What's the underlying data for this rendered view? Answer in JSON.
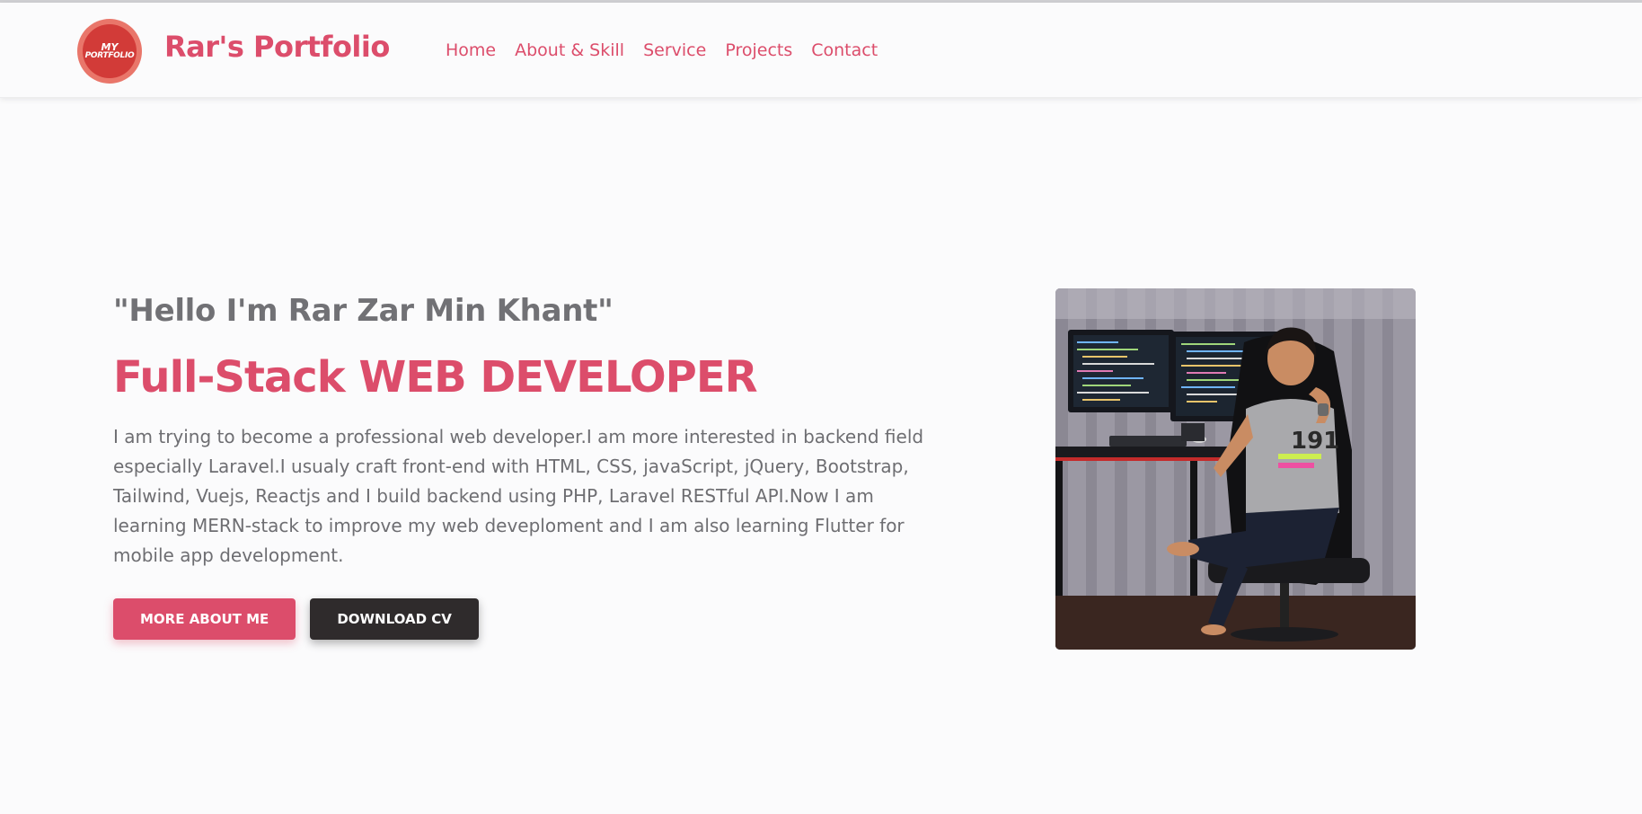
{
  "header": {
    "logo_line1": "MY",
    "logo_line2": "PORTFOLIO",
    "brand": "Rar's Portfolio",
    "nav": [
      {
        "label": "Home"
      },
      {
        "label": "About & Skill"
      },
      {
        "label": "Service"
      },
      {
        "label": "Projects"
      },
      {
        "label": "Contact"
      }
    ]
  },
  "hero": {
    "greeting": "\"Hello I'm Rar Zar Min Khant\"",
    "headline": "Full-Stack WEB DEVELOPER",
    "bio": "I am trying to become a professional web developer.I am more interested in backend field especially Laravel.I usualy craft front-end with HTML, CSS, javaScript, jQuery, Bootstrap, Tailwind, Vuejs, Reactjs and I build backend using PHP, Laravel RESTful API.Now I am learning MERN-stack to improve my web deveploment and I am also learning Flutter for mobile app development.",
    "btn_more": "MORE ABOUT ME",
    "btn_cv": "DOWNLOAD CV"
  },
  "colors": {
    "accent": "#dc4d6b",
    "dark_button": "#2f2b2c",
    "text_gray": "#6e6e72",
    "logo_red": "#d23b38"
  },
  "icons": {
    "logo": "portfolio-logo-badge"
  }
}
